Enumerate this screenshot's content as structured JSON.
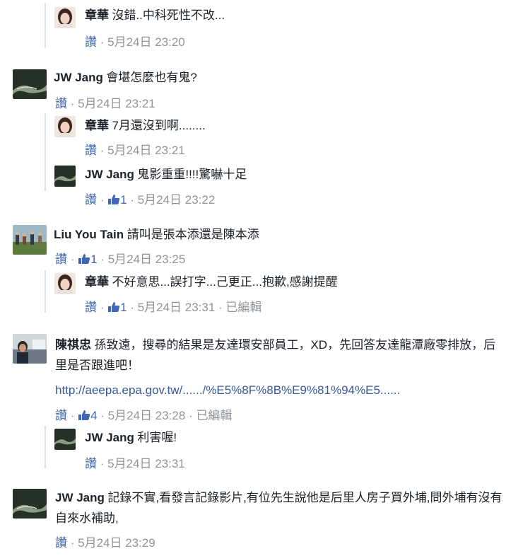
{
  "comments": [
    {
      "name": "章華",
      "text": "沒錯..中科死性不改...",
      "like": "讚",
      "time": "5月24日 23:20"
    },
    {
      "name": "JW Jang",
      "text": "會堪怎麼也有鬼?",
      "like": "讚",
      "time": "5月24日 23:21"
    },
    {
      "name": "章華",
      "text": "7月還沒到啊........",
      "like": "讚",
      "time": "5月24日 23:21"
    },
    {
      "name": "JW Jang",
      "text": "鬼影重重!!!!驚嚇十足",
      "like": "讚",
      "likes": "1",
      "time": "5月24日 23:22"
    },
    {
      "name": "Liu You Tain",
      "text": "請叫是張本添還是陳本添",
      "like": "讚",
      "likes": "1",
      "time": "5月24日 23:25"
    },
    {
      "name": "章華",
      "text": "不好意思...誤打字...己更正...抱歉,感謝提醒",
      "like": "讚",
      "likes": "1",
      "time": "5月24日 23:31",
      "edited": "已編輯"
    },
    {
      "name": "陳祺忠",
      "text": "孫致遠，搜尋的結果是友達環安部員工，XD，先回答友達龍潭廠零排放，后里是否跟進吧！",
      "link": "http://aeepa.epa.gov.tw/....../%E5%8F%8B%E9%81%94%E5......",
      "like": "讚",
      "likes": "4",
      "time": "5月24日 23:28",
      "edited": "已編輯"
    },
    {
      "name": "JW Jang",
      "text": "利害喔!",
      "like": "讚",
      "time": "5月24日 23:31"
    },
    {
      "name": "JW Jang",
      "text": "記錄不實,看發言記錄影片,有位先生說他是后里人房子買外埔,問外埔有沒有自來水補助,",
      "like": "讚",
      "time": "5月24日 23:29"
    }
  ],
  "sep": " · "
}
